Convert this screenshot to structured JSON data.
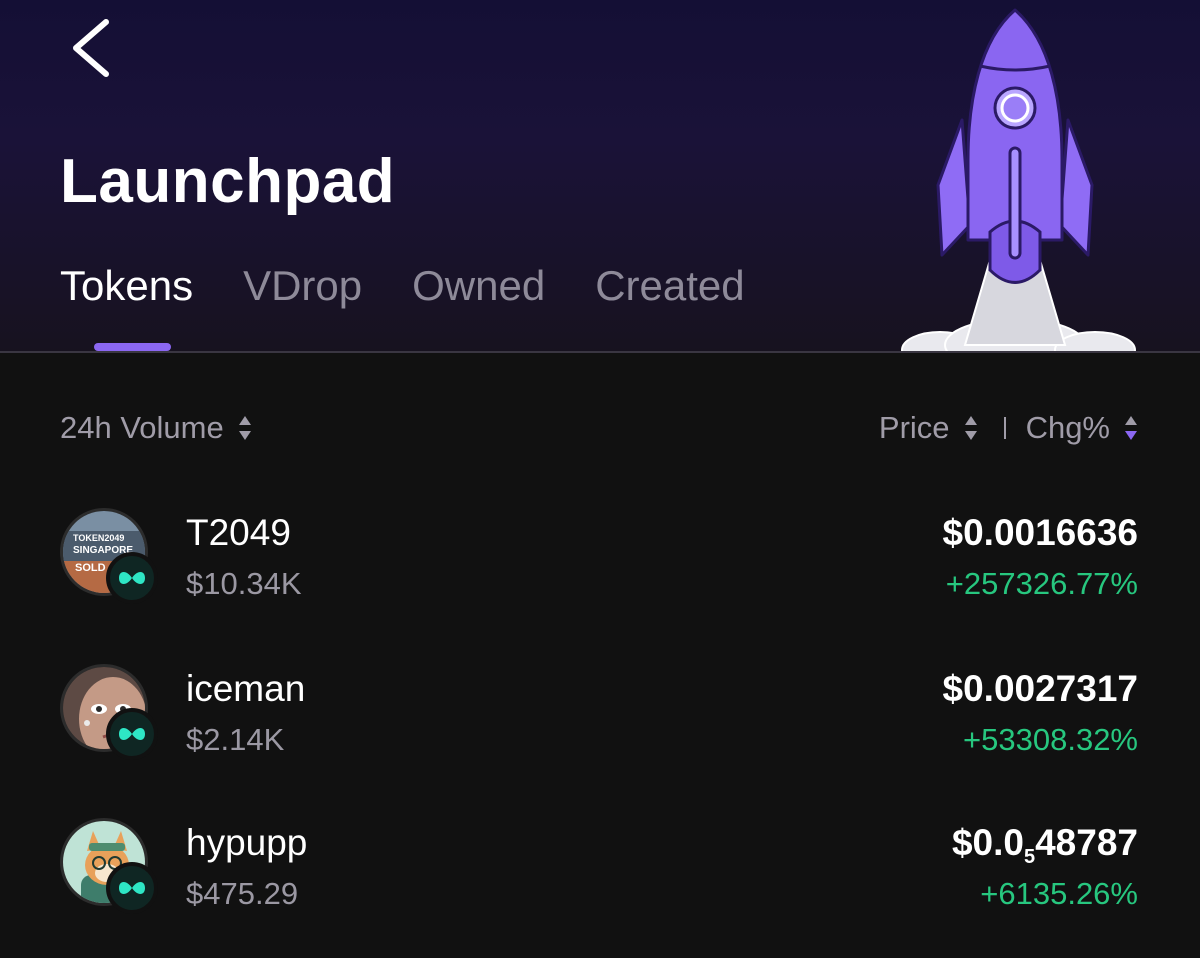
{
  "header": {
    "title": "Launchpad",
    "tabs": [
      {
        "label": "Tokens",
        "active": true
      },
      {
        "label": "VDrop",
        "active": false
      },
      {
        "label": "Owned",
        "active": false
      },
      {
        "label": "Created",
        "active": false
      }
    ]
  },
  "sort": {
    "left_label": "24h Volume",
    "price_label": "Price",
    "change_label": "Chg%"
  },
  "tokens": [
    {
      "name": "T2049",
      "volume": "$10.34K",
      "price": "$0.0016636",
      "change": "+257326.77%",
      "avatar_text": [
        "TOKEN2049",
        "SINGAPORE",
        "SOLD"
      ]
    },
    {
      "name": "iceman",
      "volume": "$2.14K",
      "price": "$0.0027317",
      "change": "+53308.32%"
    },
    {
      "name": "hypupp",
      "volume": "$475.29",
      "price_prefix": "$0.0",
      "price_sub": "5",
      "price_suffix": "48787",
      "change": "+6135.26%"
    }
  ],
  "colors": {
    "accent": "#8b67f2",
    "positive": "#27c77f",
    "badge": "#2ee6c5"
  },
  "icons": {
    "back": "chevron-left-icon",
    "sort": "sort-arrows-icon",
    "chain": "chain-logo-icon"
  }
}
